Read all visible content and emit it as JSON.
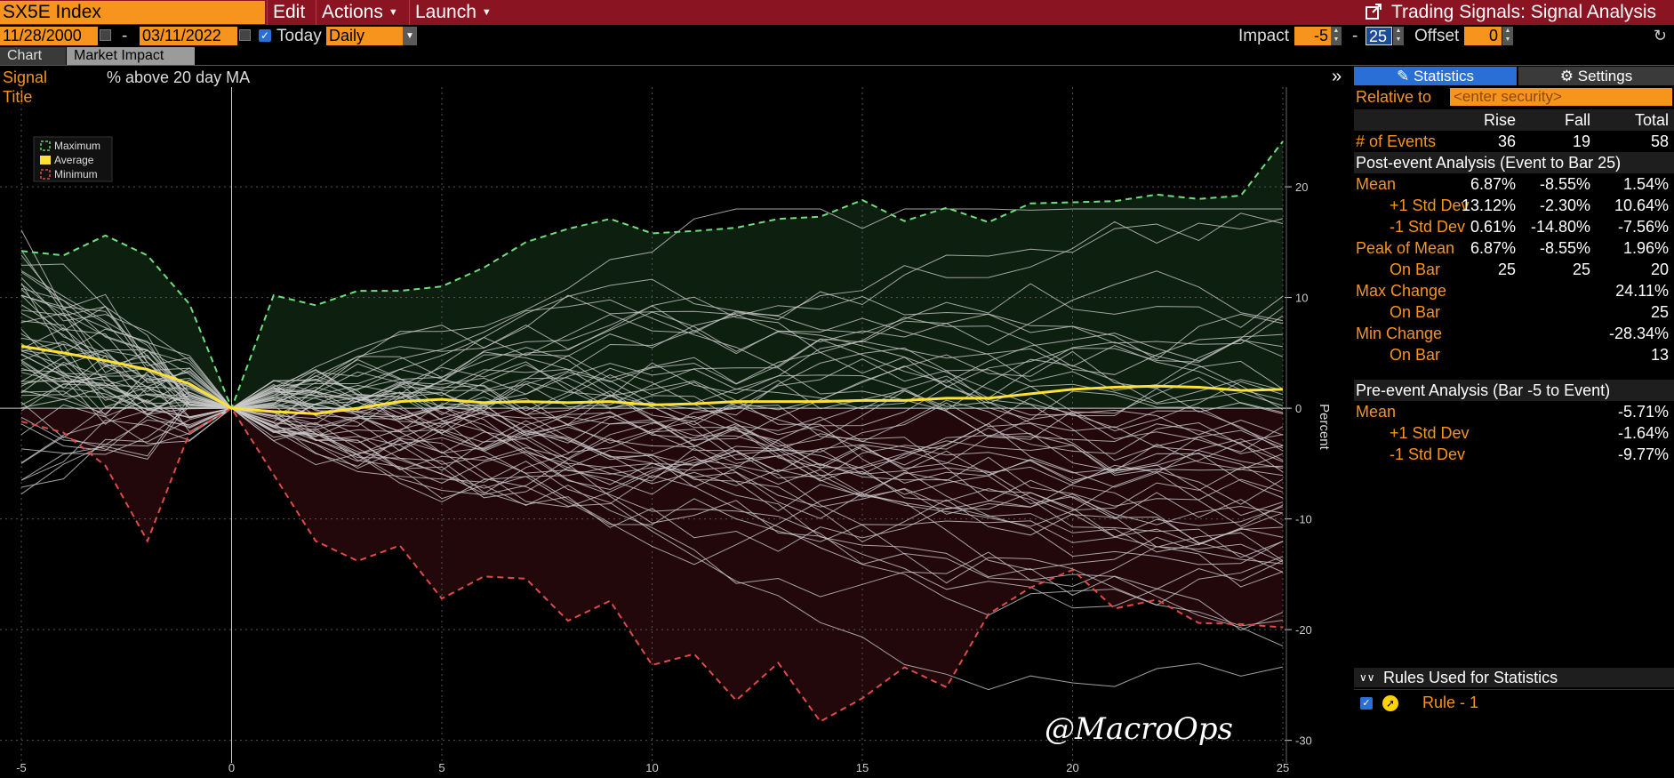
{
  "toolbar": {
    "ticker": "SX5E Index",
    "menus": [
      {
        "label": "Edit",
        "has_arrow": false
      },
      {
        "label": "Actions",
        "has_arrow": true
      },
      {
        "label": "Launch",
        "has_arrow": true
      }
    ],
    "window_title": "Trading Signals: Signal Analysis"
  },
  "controls": {
    "start_date": "11/28/2000",
    "end_date": "03/11/2022",
    "date_separator": "-",
    "today_label": "Today",
    "today_checked": true,
    "periodicity": "Daily",
    "impact_label": "Impact",
    "impact_from": "-5",
    "impact_sep": "-",
    "impact_to": "25",
    "offset_label": "Offset",
    "offset_value": "0"
  },
  "tabs": [
    {
      "label": "Chart",
      "active": false
    },
    {
      "label": "Market Impact",
      "active": true
    }
  ],
  "signal": {
    "label": "Signal Title",
    "value": "% above 20 day MA"
  },
  "watermark": "@MacroOps",
  "legend": [
    {
      "name": "Maximum",
      "color": "#5fd16f"
    },
    {
      "name": "Average",
      "color": "#ffe135"
    },
    {
      "name": "Minimum",
      "color": "#e04a4a"
    }
  ],
  "panel": {
    "tabs": [
      {
        "label": "Statistics",
        "icon": "edit-icon",
        "active": true
      },
      {
        "label": "Settings",
        "icon": "gear-icon",
        "active": false
      }
    ],
    "relative_label": "Relative to",
    "relative_placeholder": "<enter security>",
    "headers": [
      "Rise",
      "Fall",
      "Total"
    ],
    "events": {
      "label": "# of Events",
      "rise": "36",
      "fall": "19",
      "total": "58"
    },
    "post_title": "Post-event Analysis (Event to Bar 25)",
    "post_rows": [
      {
        "label": "Mean",
        "indent": false,
        "rise": "6.87%",
        "fall": "-8.55%",
        "total": "1.54%"
      },
      {
        "label": "+1 Std Dev",
        "indent": true,
        "rise": "13.12%",
        "fall": "-2.30%",
        "total": "10.64%"
      },
      {
        "label": "-1 Std Dev",
        "indent": true,
        "rise": "0.61%",
        "fall": "-14.80%",
        "total": "-7.56%"
      },
      {
        "label": "Peak of Mean",
        "indent": false,
        "rise": "6.87%",
        "fall": "-8.55%",
        "total": "1.96%"
      },
      {
        "label": "On Bar",
        "indent": true,
        "rise": "25",
        "fall": "25",
        "total": "20"
      },
      {
        "label": "Max Change",
        "indent": false,
        "rise": "",
        "fall": "",
        "total": "24.11%"
      },
      {
        "label": "On Bar",
        "indent": true,
        "rise": "",
        "fall": "",
        "total": "25"
      },
      {
        "label": "Min Change",
        "indent": false,
        "rise": "",
        "fall": "",
        "total": "-28.34%"
      },
      {
        "label": "On Bar",
        "indent": true,
        "rise": "",
        "fall": "",
        "total": "13"
      }
    ],
    "pre_title": "Pre-event Analysis (Bar -5 to Event)",
    "pre_rows": [
      {
        "label": "Mean",
        "indent": false,
        "total": "-5.71%"
      },
      {
        "label": "+1 Std Dev",
        "indent": true,
        "total": "-1.64%"
      },
      {
        "label": "-1 Std Dev",
        "indent": true,
        "total": "-9.77%"
      }
    ],
    "rules_title": "Rules Used for Statistics",
    "rules": [
      {
        "label": "Rule - 1",
        "checked": true
      }
    ]
  },
  "chart_data": {
    "type": "line",
    "xlim": [
      -5,
      25
    ],
    "ylim": [
      -33,
      29
    ],
    "xticks": [
      -5,
      0,
      5,
      10,
      15,
      20,
      25
    ],
    "yticks": [
      20,
      10,
      0,
      -10,
      -20,
      -30
    ],
    "ylabel": "Percent",
    "grid": true,
    "legend_position": "top-left",
    "x": [
      -5,
      -4,
      -3,
      -2,
      -1,
      0,
      1,
      2,
      3,
      4,
      5,
      6,
      7,
      8,
      9,
      10,
      11,
      12,
      13,
      14,
      15,
      16,
      17,
      18,
      19,
      20,
      21,
      22,
      23,
      24,
      25
    ],
    "series": [
      {
        "name": "Maximum",
        "values": [
          14.2,
          13.8,
          15.6,
          13.8,
          9.4,
          0,
          10.2,
          9.3,
          10.6,
          10.6,
          11,
          12.7,
          15,
          16.2,
          17.1,
          15.8,
          16,
          16.3,
          17.1,
          17.3,
          18.8,
          16.9,
          18.1,
          16.8,
          18.5,
          18.6,
          18.7,
          19.3,
          18.9,
          19.2,
          24.1
        ]
      },
      {
        "name": "Average",
        "values": [
          5.6,
          5,
          4.3,
          3.5,
          2.2,
          0,
          -0.3,
          -0.5,
          0,
          0.6,
          0.8,
          0.5,
          0.6,
          0.5,
          0.6,
          0.3,
          0.4,
          0.6,
          0.6,
          0.6,
          0.7,
          0.7,
          0.9,
          0.9,
          1.3,
          1.7,
          1.9,
          2,
          1.9,
          1.6,
          1.7
        ]
      },
      {
        "name": "Minimum",
        "values": [
          -1.2,
          -2.2,
          -5.2,
          -12,
          -2.2,
          0,
          -6,
          -12,
          -13.8,
          -12.4,
          -17.2,
          -15.2,
          -15.4,
          -19.2,
          -17.4,
          -23.2,
          -22.2,
          -26.4,
          -23,
          -28.3,
          -26.2,
          -23.4,
          -25.2,
          -18.6,
          -16.2,
          -14.6,
          -18.1,
          -17.3,
          -19.4,
          -19.5,
          -19.8
        ]
      }
    ]
  }
}
